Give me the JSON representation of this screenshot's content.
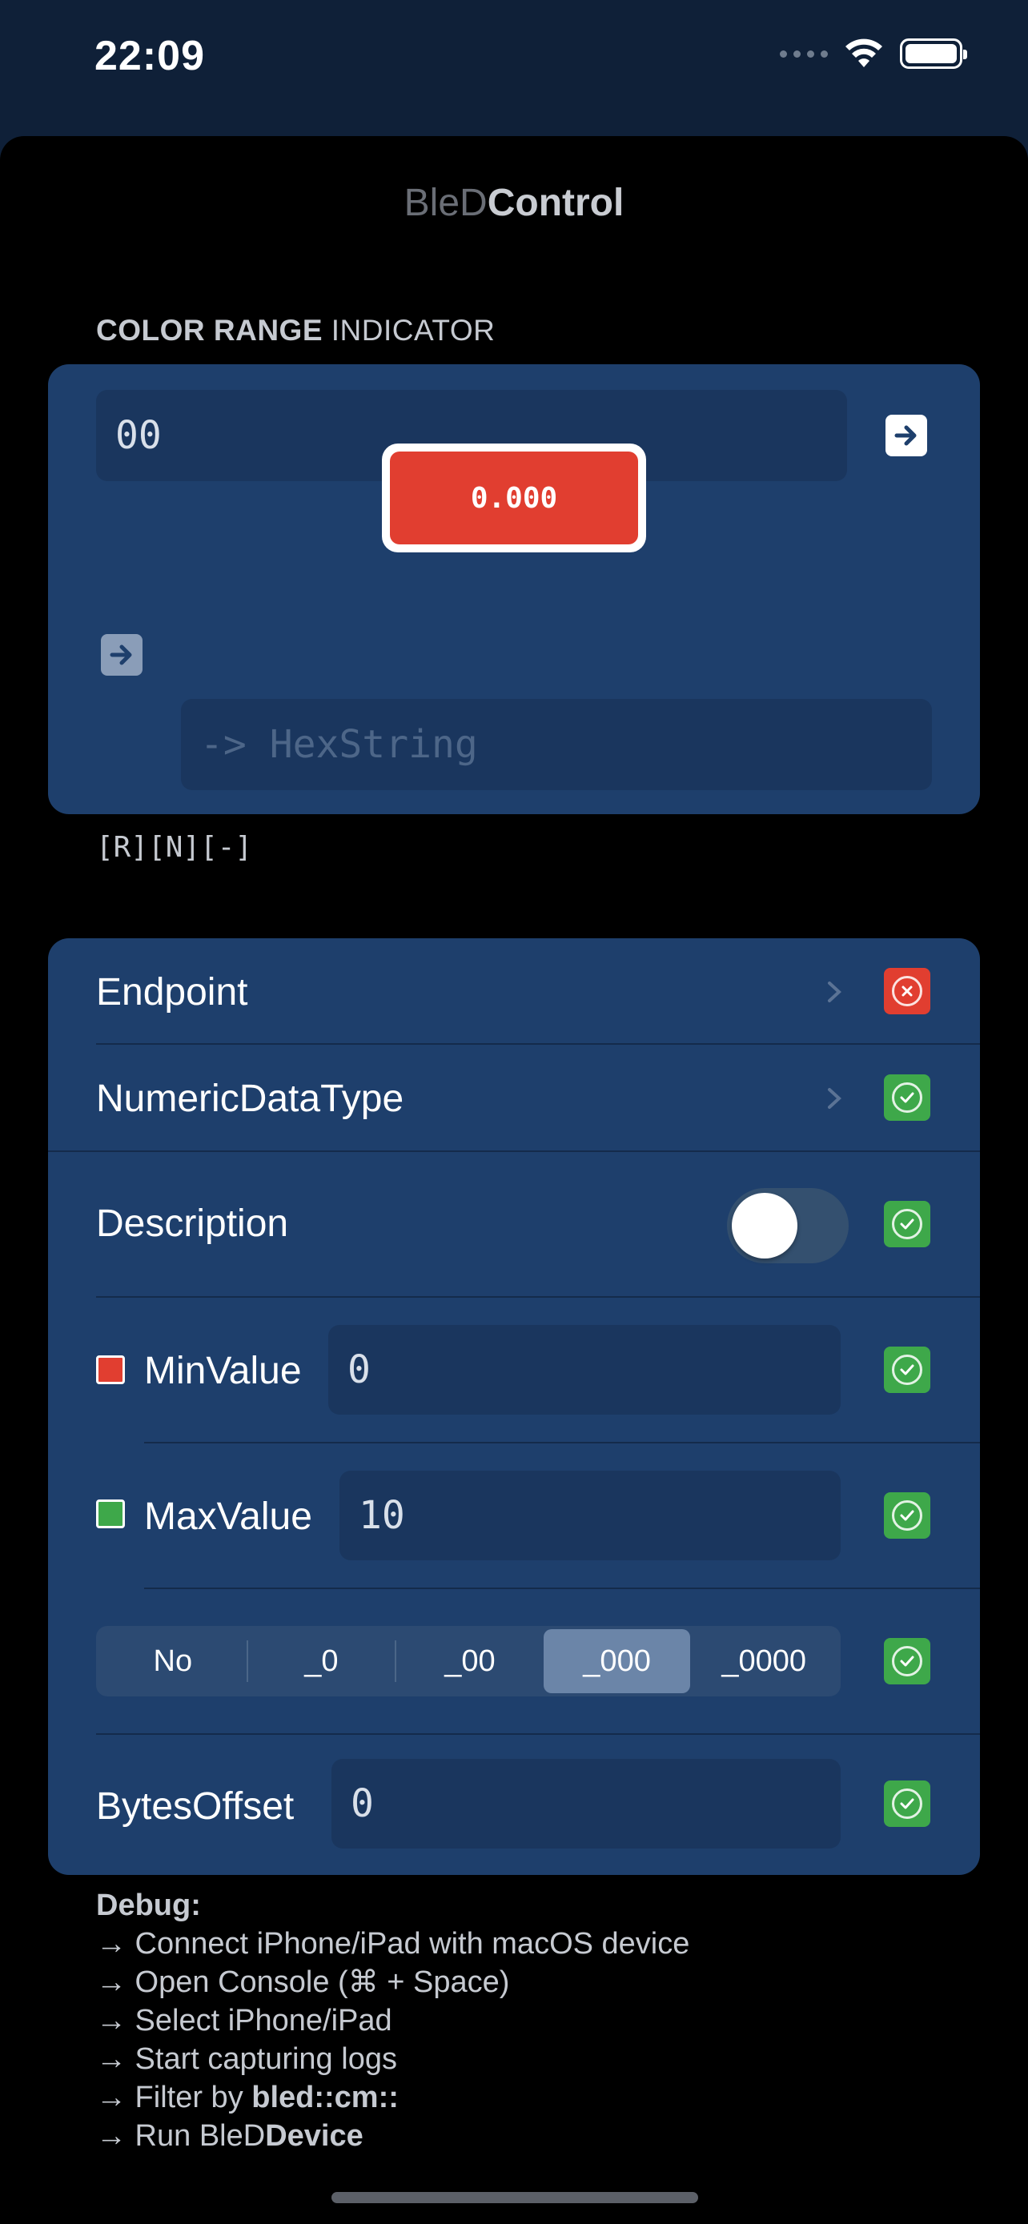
{
  "status_bar": {
    "time": "22:09"
  },
  "nav": {
    "title_light": "BleD",
    "title_bold": "Control"
  },
  "color_range": {
    "header_bold": "COLOR RANGE",
    "header_regular": "INDICATOR",
    "hex_value": "00",
    "indicator_value": "0.000",
    "hexstring_placeholder": "-> HexString",
    "flags": "[R][N][-]"
  },
  "settings": {
    "endpoint_label": "Endpoint",
    "numeric_type_label": "NumericDataType",
    "description_label": "Description",
    "description_on": false,
    "min_label": "MinValue",
    "min_value": "0",
    "min_color": "#e13e30",
    "max_label": "MaxValue",
    "max_value": "10",
    "max_color": "#3ea84a",
    "precision_options": [
      "No",
      "_0",
      "_00",
      "_000",
      "_0000"
    ],
    "precision_selected": "_000",
    "bytes_offset_label": "BytesOffset",
    "bytes_offset_value": "0"
  },
  "debug": {
    "title": "Debug:",
    "line1": "→ Connect iPhone/iPad with macOS device",
    "line2": "→ Open Console (⌘ + Space)",
    "line3": "→ Select iPhone/iPad",
    "line4": "→ Start capturing logs",
    "line5_prefix": "→ Filter by ",
    "line5_bold": "bled::cm::",
    "line6_prefix": "→ Run BleD",
    "line6_bold": "Device"
  },
  "colors": {
    "accent_ok": "#3ea84a",
    "accent_error": "#e13e30",
    "card": "#1e3f6c"
  }
}
